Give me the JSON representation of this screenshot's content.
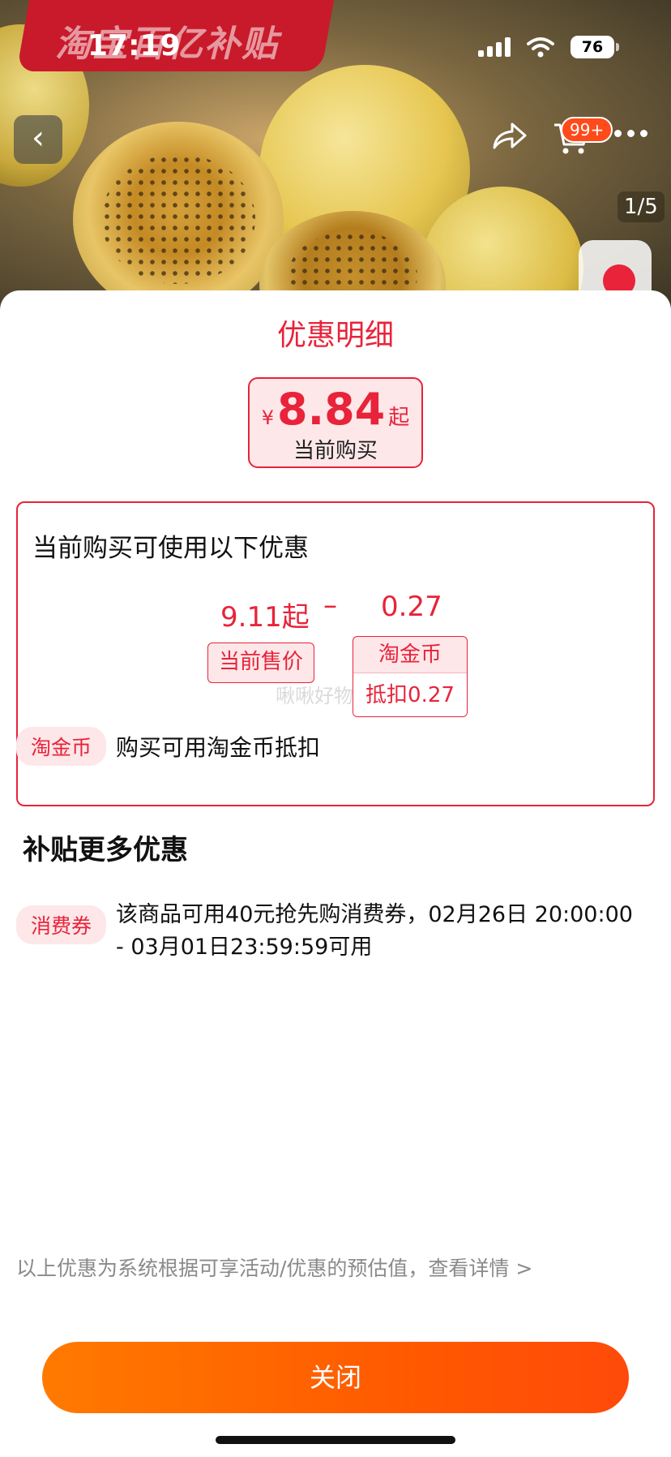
{
  "status_bar": {
    "time": "17:19",
    "battery": "76"
  },
  "hero": {
    "promo_banner": "淘宝百亿补贴",
    "page_indicator": "1/5",
    "cart_badge": "99+"
  },
  "sheet": {
    "title": "优惠明细",
    "price_box": {
      "currency": "¥",
      "value": "8.84",
      "suffix": "起",
      "label": "当前购买"
    },
    "breakdown": {
      "title": "当前购买可使用以下优惠",
      "current_price_amount": "9.11起",
      "minus_sign": "–",
      "coin_amount": "0.27",
      "current_price_tag": "当前售价",
      "coin_tag_title": "淘金币",
      "coin_tag_detail": "抵扣0.27",
      "watermark": "啾啾好物"
    },
    "coin_row": {
      "tag": "淘金币",
      "text": "购买可用淘金币抵扣"
    },
    "section_title": "补贴更多优惠",
    "voucher_row": {
      "tag": "消费券",
      "text": "该商品可用40元抢先购消费券，02月26日 20:00:00 - 03月01日23:59:59可用"
    },
    "footer_note": "以上优惠为系统根据可享活动/优惠的预估值，查看详情 >",
    "close_label": "关闭"
  },
  "colors": {
    "accent": "#e8233a",
    "button": "#ff6a00",
    "tag_bg": "#fde7e9"
  },
  "icons": [
    "back-icon",
    "share-icon",
    "cart-icon",
    "more-icon",
    "signal-icon",
    "wifi-icon",
    "battery-icon"
  ]
}
